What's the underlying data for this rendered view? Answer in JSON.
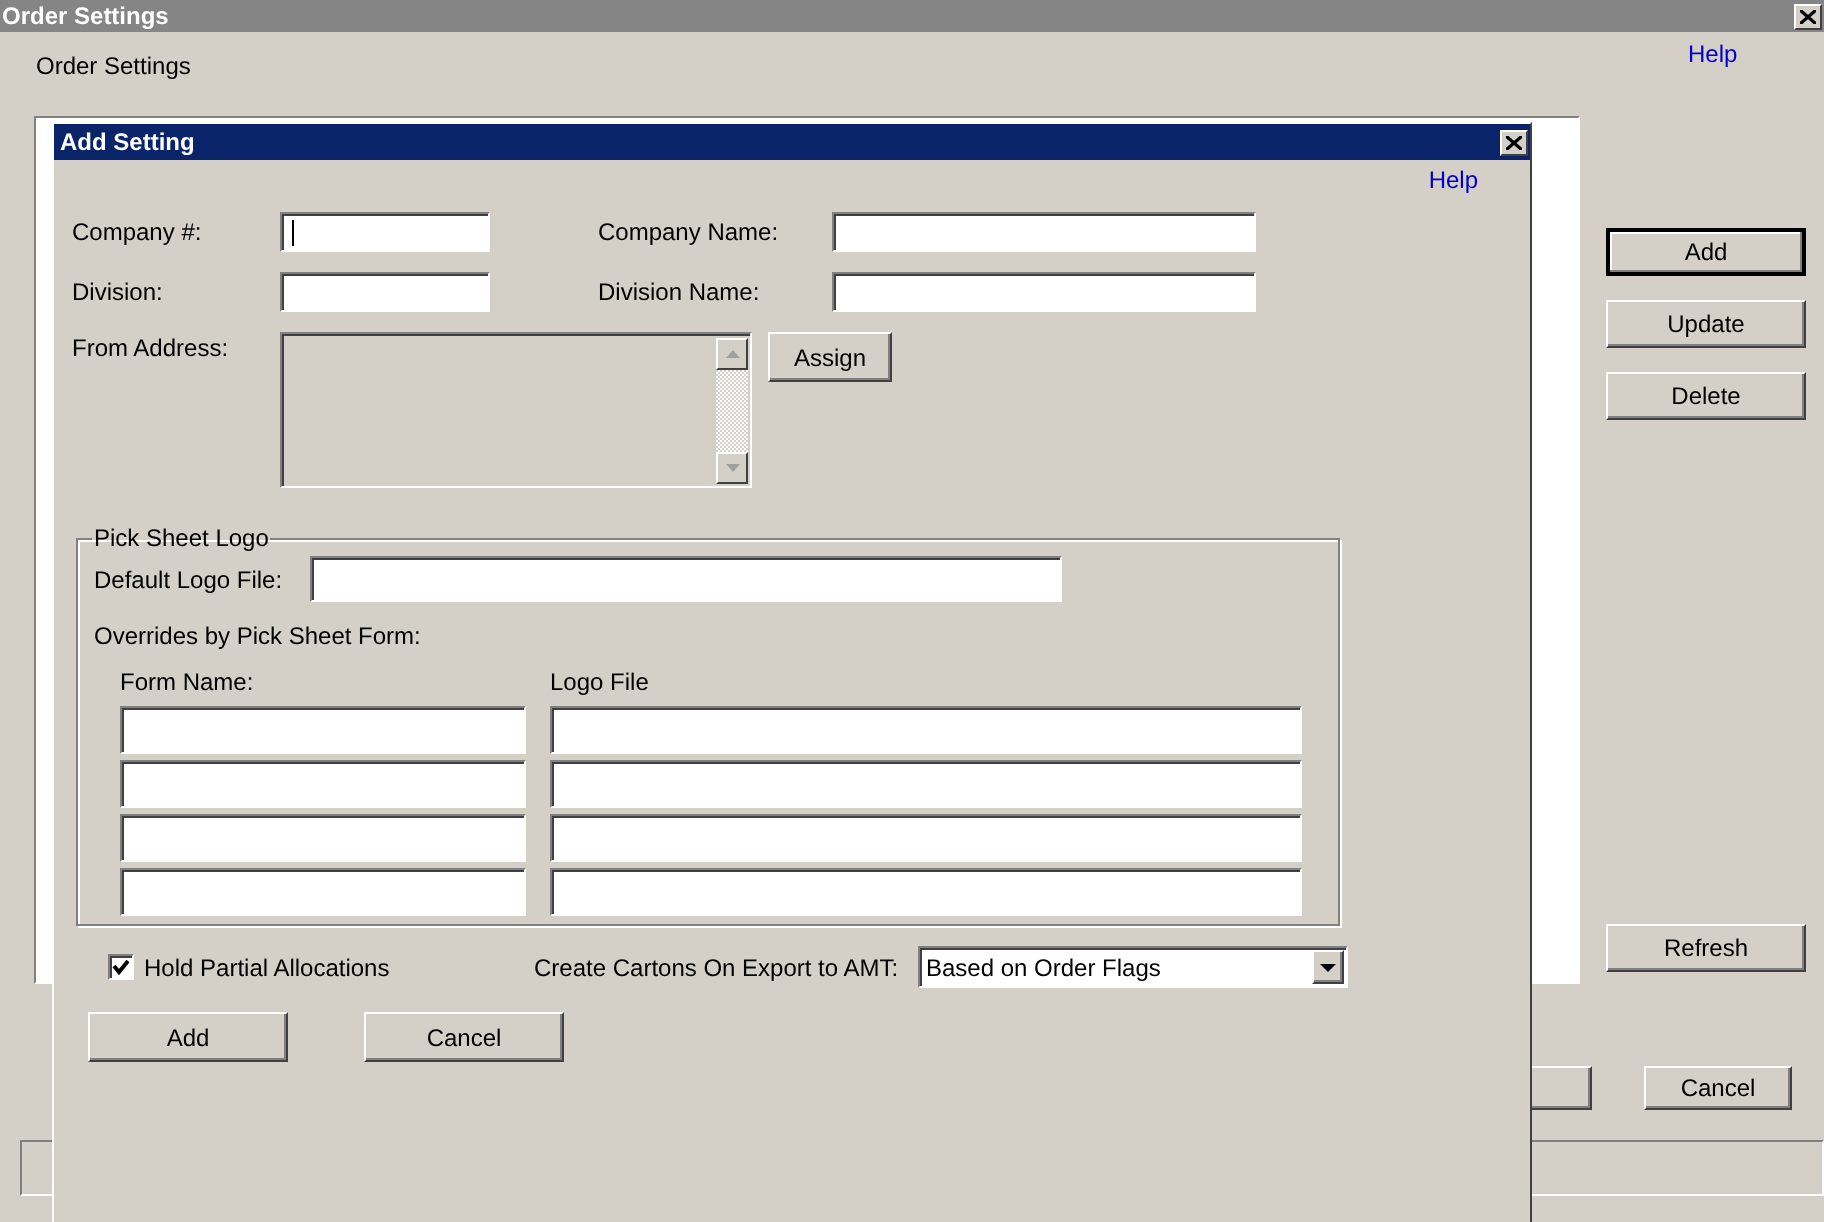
{
  "main_window": {
    "title": "Order Settings",
    "heading": "Order Settings",
    "help_link": "Help",
    "side_buttons": [
      {
        "label": "Add",
        "default": true
      },
      {
        "label": "Update",
        "default": false
      },
      {
        "label": "Delete",
        "default": false
      }
    ],
    "refresh_button": "Refresh",
    "cancel_button": "Cancel"
  },
  "dialog": {
    "title": "Add Setting",
    "help_link": "Help",
    "company_number": {
      "label": "Company #:",
      "focused": true
    },
    "company_name": {
      "label": "Company Name:"
    },
    "division": {
      "label": "Division:"
    },
    "division_name": {
      "label": "Division Name:"
    },
    "from_address": {
      "label": "From Address:"
    },
    "assign_button": "Assign",
    "pick_sheet_logo": {
      "title": "Pick Sheet Logo",
      "default_logo_label": "Default Logo File:",
      "overrides_label": "Overrides by Pick Sheet Form:",
      "columns": [
        "Form Name:",
        "Logo File"
      ]
    },
    "hold_partial_allocations": {
      "label": "Hold Partial Allocations",
      "checked": true
    },
    "create_cartons": {
      "label": "Create Cartons On Export to AMT:",
      "value": "Based on Order Flags"
    },
    "buttons": [
      "Add",
      "Cancel"
    ]
  }
}
